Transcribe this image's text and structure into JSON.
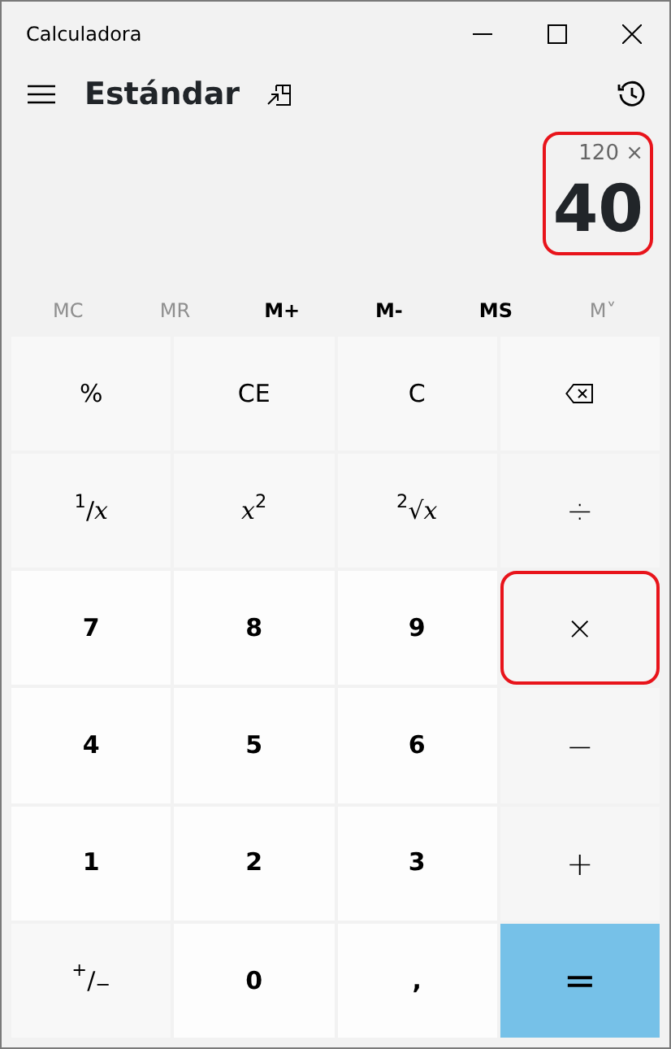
{
  "window": {
    "title": "Calculadora"
  },
  "header": {
    "mode": "Estándar"
  },
  "display": {
    "expression": "120 ×",
    "value": "40",
    "highlighted": true
  },
  "memory": [
    {
      "label": "MC",
      "disabled": true
    },
    {
      "label": "MR",
      "disabled": true
    },
    {
      "label": "M+",
      "disabled": false
    },
    {
      "label": "M-",
      "disabled": false
    },
    {
      "label": "MS",
      "disabled": false
    },
    {
      "label": "M˅",
      "disabled": true
    }
  ],
  "keys": [
    {
      "kind": "function",
      "label": "%",
      "highlighted": false
    },
    {
      "kind": "function",
      "label": "CE",
      "highlighted": false
    },
    {
      "kind": "function",
      "label": "C",
      "highlighted": false
    },
    {
      "kind": "backspace",
      "highlighted": false
    },
    {
      "kind": "function",
      "label": "$^{1}$/*x*",
      "highlighted": false
    },
    {
      "kind": "function",
      "label": "*x*$^{2}$",
      "highlighted": false
    },
    {
      "kind": "function",
      "label": "$^{2}$√*x*",
      "highlighted": false
    },
    {
      "kind": "operator",
      "label": "÷",
      "highlighted": false
    },
    {
      "kind": "digit",
      "label": "7",
      "highlighted": false
    },
    {
      "kind": "digit",
      "label": "8",
      "highlighted": false
    },
    {
      "kind": "digit",
      "label": "9",
      "highlighted": false
    },
    {
      "kind": "operator",
      "label": "×",
      "highlighted": true
    },
    {
      "kind": "digit",
      "label": "4",
      "highlighted": false
    },
    {
      "kind": "digit",
      "label": "5",
      "highlighted": false
    },
    {
      "kind": "digit",
      "label": "6",
      "highlighted": false
    },
    {
      "kind": "operator",
      "label": "−",
      "highlighted": false
    },
    {
      "kind": "digit",
      "label": "1",
      "highlighted": false
    },
    {
      "kind": "digit",
      "label": "2",
      "highlighted": false
    },
    {
      "kind": "digit",
      "label": "3",
      "highlighted": false
    },
    {
      "kind": "operator",
      "label": "+",
      "highlighted": false
    },
    {
      "kind": "function",
      "label": "$^{+}$/$_{−}$",
      "highlighted": false
    },
    {
      "kind": "digit",
      "label": "0",
      "highlighted": false
    },
    {
      "kind": "digit",
      "label": ",",
      "highlighted": false
    },
    {
      "kind": "equals",
      "label": "=",
      "highlighted": false
    }
  ]
}
